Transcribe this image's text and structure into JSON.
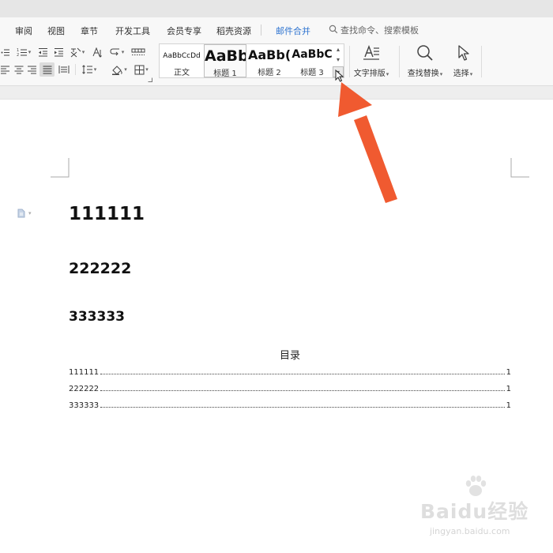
{
  "tabs": [
    {
      "label": "审阅"
    },
    {
      "label": "视图"
    },
    {
      "label": "章节"
    },
    {
      "label": "开发工具"
    },
    {
      "label": "会员专享"
    },
    {
      "label": "稻壳资源"
    },
    {
      "label": "邮件合并"
    }
  ],
  "search": {
    "placeholder": "查找命令、搜索模板"
  },
  "styles": [
    {
      "preview": "AaBbCcDd",
      "name": "正文"
    },
    {
      "preview": "AaBb",
      "name": "标题 1"
    },
    {
      "preview": "AaBb(",
      "name": "标题 2"
    },
    {
      "preview": "AaBbC",
      "name": "标题 3"
    }
  ],
  "ribbon_buttons": {
    "text_layout": "文字排版",
    "find_replace": "查找替换",
    "select": "选择"
  },
  "document": {
    "headings": [
      "111111",
      "222222",
      "333333"
    ],
    "toc": {
      "title": "目录",
      "entries": [
        {
          "text": "111111",
          "page": "1"
        },
        {
          "text": "222222",
          "page": "1"
        },
        {
          "text": "333333",
          "page": "1"
        }
      ]
    }
  },
  "watermark": {
    "brand": "Baidu经验",
    "url": "jingyan.baidu.com"
  },
  "annotation": {
    "arrow_color": "#f05a30",
    "points_to": "style-gallery-expand-button"
  },
  "colors": {
    "accent_tab": "#2f74d0",
    "arrow": "#f05a30"
  }
}
